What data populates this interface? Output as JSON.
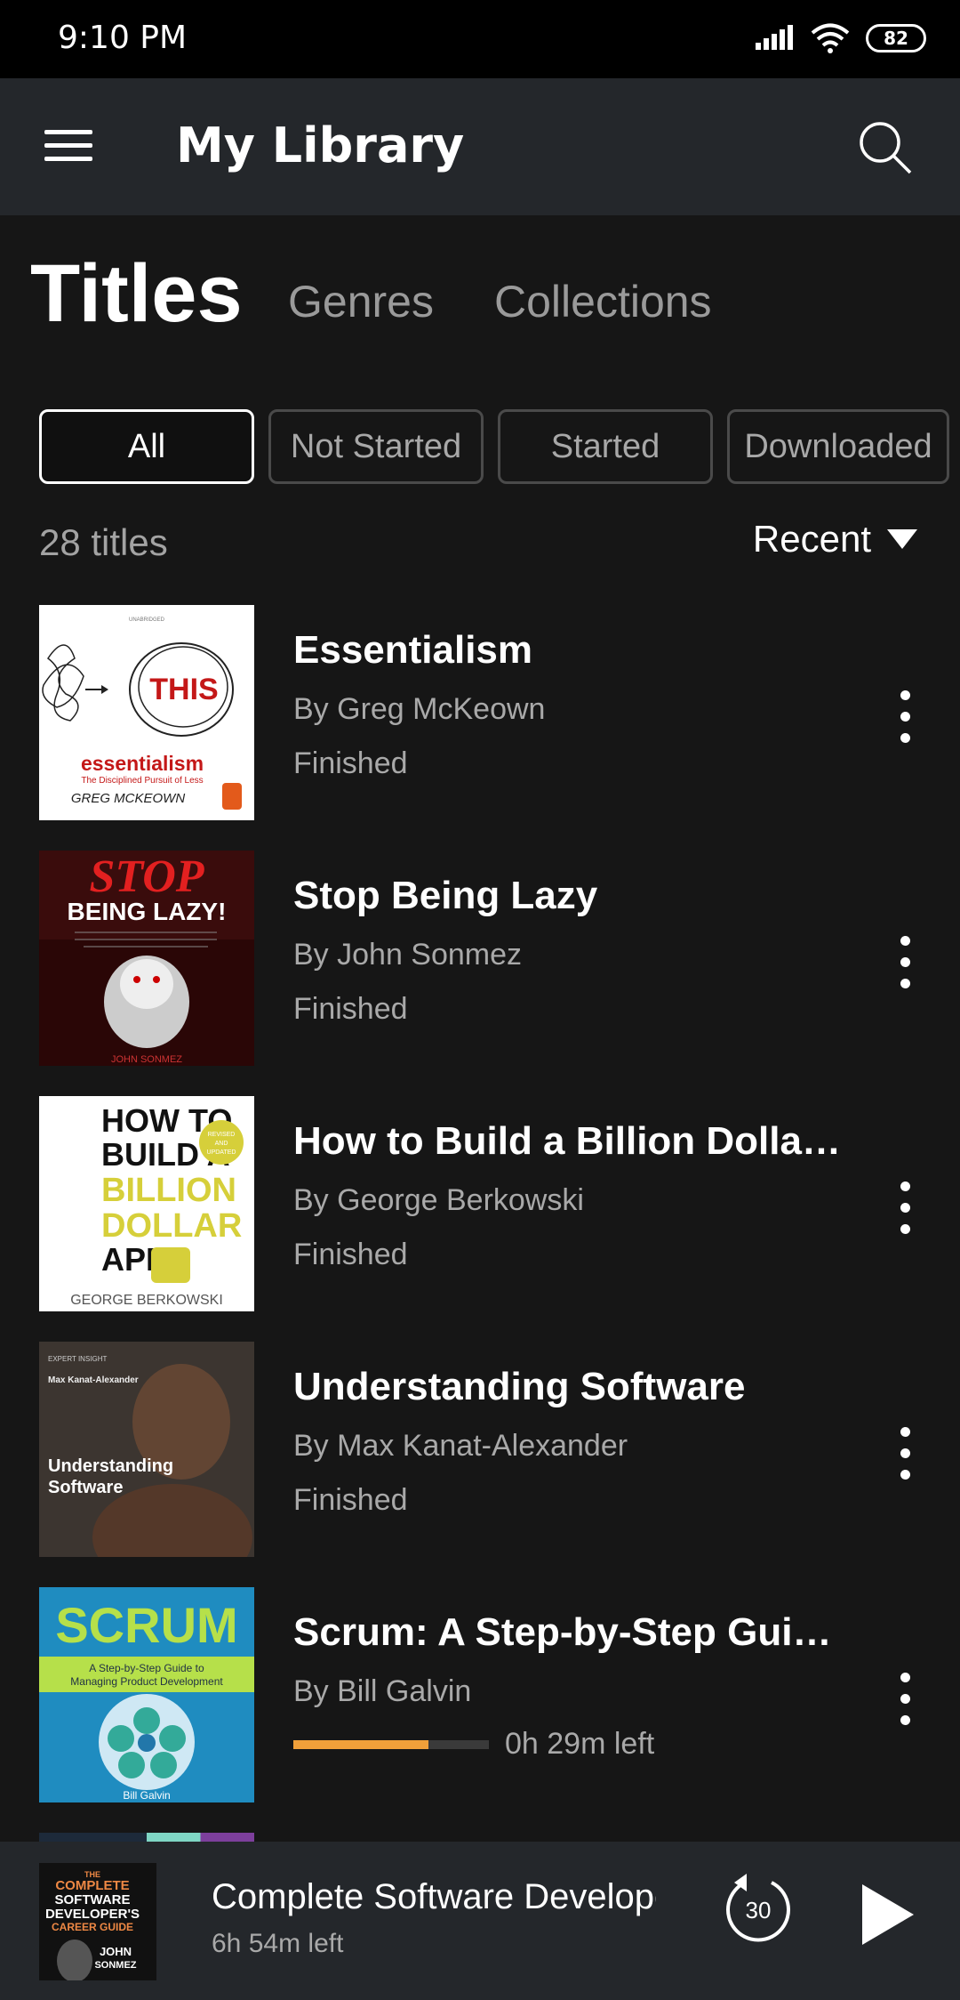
{
  "status_bar": {
    "time": "9:10 PM",
    "battery": "82"
  },
  "app_bar": {
    "title": "My Library"
  },
  "tabs": [
    {
      "label": "Titles",
      "active": true
    },
    {
      "label": "Genres",
      "active": false
    },
    {
      "label": "Collections",
      "active": false
    }
  ],
  "filters": [
    {
      "label": "All",
      "active": true
    },
    {
      "label": "Not Started",
      "active": false
    },
    {
      "label": "Started",
      "active": false
    },
    {
      "label": "Downloaded",
      "active": false
    }
  ],
  "count": "28 titles",
  "sort": {
    "label": "Recent"
  },
  "books": [
    {
      "title": "Essentialism",
      "author": "By Greg McKeown",
      "status": "Finished",
      "cover": {
        "bg": "#ffffff",
        "line1": "THIS",
        "line2": "essentialism",
        "line3": "The Disciplined Pursuit of Less",
        "line4": "GREG MCKEOWN",
        "line5": "UNABRIDGED"
      }
    },
    {
      "title": "Stop Being Lazy",
      "author": "By John Sonmez",
      "status": "Finished",
      "cover": {
        "bg": "#3a0c0c",
        "line1": "STOP",
        "line2": "BEING LAZY!",
        "line3": "JOHN SONMEZ"
      }
    },
    {
      "title": "How to Build a Billion Dollar App",
      "author": "By George Berkowski",
      "status": "Finished",
      "cover": {
        "bg": "#ffffff",
        "line1": "HOW TO",
        "line2": "BUILD A",
        "line3": "BILLION",
        "line4": "DOLLAR",
        "line5": "APP",
        "line6": "GEORGE BERKOWSKI",
        "badge1": "REVISED",
        "badge2": "AND",
        "badge3": "UPDATED"
      }
    },
    {
      "title": "Understanding Software",
      "author": "By Max Kanat-Alexander",
      "status": "Finished",
      "cover": {
        "bg": "#4a3a30",
        "line1": "EXPERT INSIGHT",
        "line2": "Max Kanat-Alexander",
        "line3": "Understanding",
        "line4": "Software"
      }
    },
    {
      "title": "Scrum: A Step-by-Step Guide t...",
      "author": "By Bill Galvin",
      "progress": 0.69,
      "time_left": "0h 29m left",
      "cover": {
        "bg": "#1f8cc0",
        "line1": "SCRUM",
        "line2": "A Step-by-Step Guide to",
        "line3": "Managing Product Development",
        "line4": "Bill Galvin"
      }
    }
  ],
  "player": {
    "title": "Complete Software Develope",
    "time_left": "6h 54m left",
    "rewind_label": "30",
    "cover": {
      "line1": "THE",
      "line2": "COMPLETE",
      "line3": "SOFTWARE",
      "line4": "DEVELOPER'S",
      "line5": "CAREER GUIDE",
      "line6": "JOHN",
      "line7": "SONMEZ"
    }
  },
  "colors": {
    "accent": "#f0a03a",
    "background": "#161616",
    "bar": "#24272b"
  }
}
